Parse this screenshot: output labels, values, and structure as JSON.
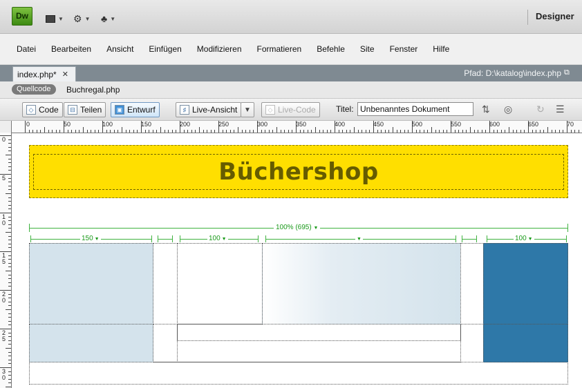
{
  "app": {
    "logo": "Dw",
    "toolbar_icons": [
      "layout-icon",
      "gear-icon",
      "sitemap-icon"
    ],
    "workspace": "Designer"
  },
  "menu": [
    "Datei",
    "Bearbeiten",
    "Ansicht",
    "Einfügen",
    "Modifizieren",
    "Formatieren",
    "Befehle",
    "Site",
    "Fenster",
    "Hilfe"
  ],
  "document": {
    "tab_label": "index.php*",
    "path": "Pfad:  D:\\katalog\\index.php",
    "source_label": "Quellcode",
    "related_file": "Buchregal.php"
  },
  "doc_toolbar": {
    "code": "Code",
    "split": "Teilen",
    "design": "Entwurf",
    "live_view": "Live-Ansicht",
    "live_code": "Live-Code",
    "title_label": "Titel:",
    "title_value": "Unbenanntes Dokument"
  },
  "ruler": {
    "top": [
      "0",
      "50",
      "100",
      "150",
      "200",
      "250",
      "300",
      "350",
      "400",
      "450",
      "500",
      "550",
      "600",
      "650",
      "70"
    ],
    "left": [
      "0",
      "5",
      "10",
      "15",
      "20",
      "25",
      "30"
    ]
  },
  "canvas": {
    "heading": "Büchershop",
    "table_width": "100% (695)",
    "col_widths": [
      "150",
      "100",
      "100"
    ],
    "colors": {
      "banner": "#ffdf00",
      "light_blue": "#d4e3ec",
      "dark_blue": "#2e78a8",
      "guide_green": "#3fb23f"
    }
  }
}
